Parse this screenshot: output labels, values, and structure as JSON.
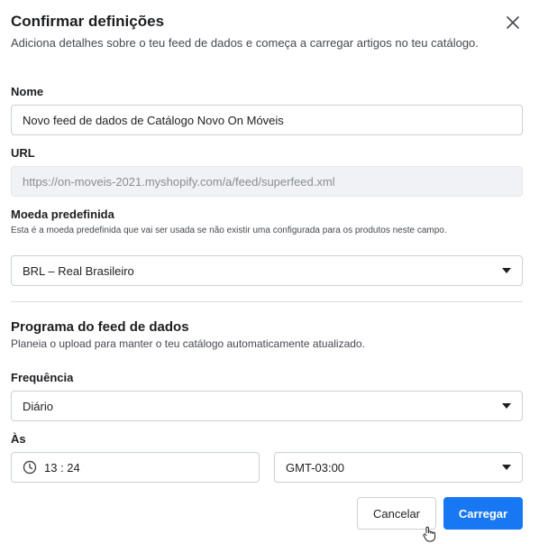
{
  "dialog": {
    "title": "Confirmar definições",
    "subtitle": "Adiciona detalhes sobre o teu feed de dados e começa a carregar artigos no teu catálogo."
  },
  "fields": {
    "name": {
      "label": "Nome",
      "value": "Novo feed de dados de Catálogo Novo On Móveis"
    },
    "url": {
      "label": "URL",
      "value": "https://on-moveis-2021.myshopify.com/a/feed/superfeed.xml"
    },
    "currency": {
      "label": "Moeda predefinida",
      "hint": "Esta é a moeda predefinida que vai ser usada se não existir uma configurada para os produtos neste campo.",
      "value": "BRL – Real Brasileiro"
    }
  },
  "schedule": {
    "title": "Programa do feed de dados",
    "subtitle": "Planeia o upload para manter o teu catálogo automaticamente atualizado.",
    "frequency": {
      "label": "Frequência",
      "value": "Diário"
    },
    "time": {
      "label": "Às",
      "value": "13 : 24"
    },
    "timezone": {
      "value": "GMT-03:00"
    }
  },
  "buttons": {
    "cancel": "Cancelar",
    "submit": "Carregar"
  },
  "colors": {
    "primary": "#1877f2",
    "border": "#ccd0d5",
    "disabled_bg": "#f0f2f5"
  }
}
